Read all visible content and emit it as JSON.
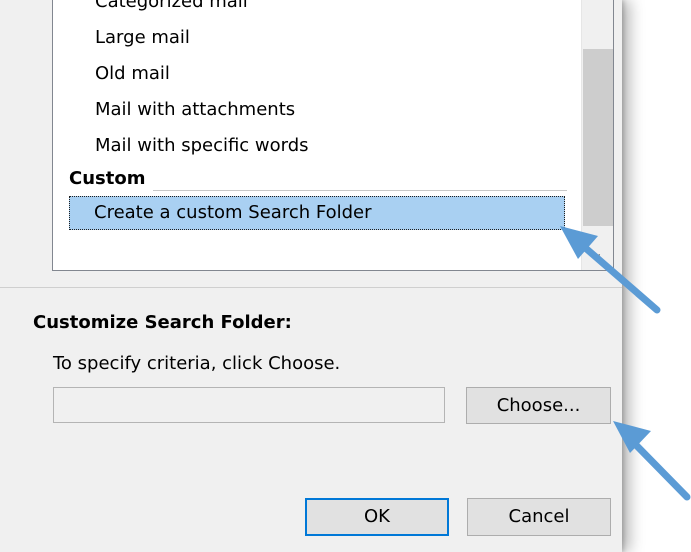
{
  "search_folder_list": {
    "items": [
      {
        "label": "Categorized mail"
      },
      {
        "label": "Large mail"
      },
      {
        "label": "Old mail"
      },
      {
        "label": "Mail with attachments"
      },
      {
        "label": "Mail with specific words"
      }
    ],
    "custom_header": "Custom",
    "selected_item": {
      "label": "Create a custom Search Folder"
    }
  },
  "customize": {
    "section_label": "Customize Search Folder:",
    "instruction": "To specify criteria, click Choose.",
    "criteria_value": "",
    "choose_label": "Choose..."
  },
  "buttons": {
    "ok_label": "OK",
    "cancel_label": "Cancel"
  },
  "icons": {
    "scroll_down": "chevron-down-icon",
    "annotation_arrow": "arrow-icon"
  },
  "colors": {
    "dialog_background": "#f0f0f0",
    "selection_highlight": "#a9d0f2",
    "annotation_arrow": "#5b9bd5",
    "default_button_border": "#0078d7"
  }
}
